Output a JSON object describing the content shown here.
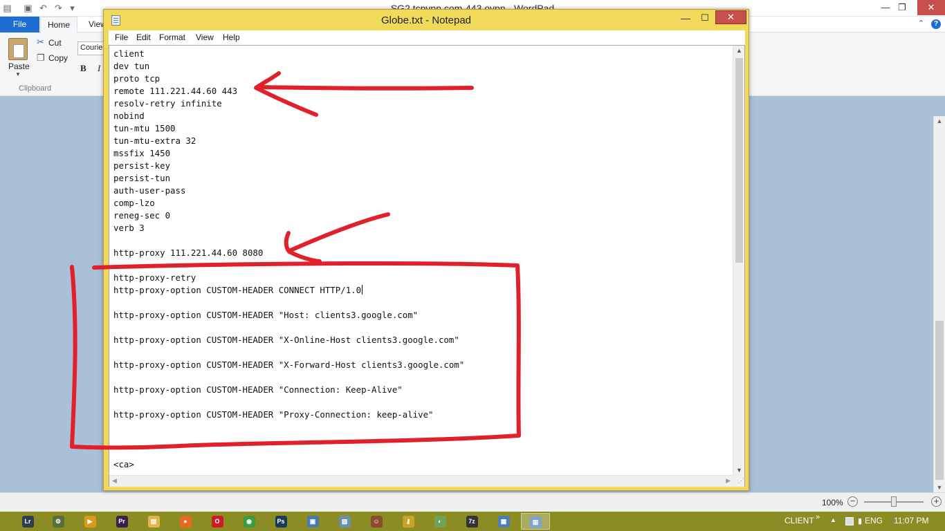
{
  "wordpad": {
    "title": "SG2.tcpvpn.com-443.ovpn - WordPad",
    "tabs": {
      "file": "File",
      "home": "Home",
      "view": "View"
    },
    "ribbon": {
      "paste": "Paste",
      "cut": "Cut",
      "copy": "Copy",
      "clipboard_group": "Clipboard",
      "font_name": "Courier",
      "bold": "B",
      "italic": "I"
    },
    "status": {
      "zoom": "100%"
    }
  },
  "notepad": {
    "title": "Globe.txt - Notepad",
    "menu": [
      "File",
      "Edit",
      "Format",
      "View",
      "Help"
    ],
    "lines": [
      "client",
      "dev tun",
      "proto tcp",
      "remote 111.221.44.60 443",
      "resolv-retry infinite",
      "nobind",
      "tun-mtu 1500",
      "tun-mtu-extra 32",
      "mssfix 1450",
      "persist-key",
      "persist-tun",
      "auth-user-pass",
      "comp-lzo",
      "reneg-sec 0",
      "verb 3",
      "",
      "http-proxy 111.221.44.60 8080",
      "",
      "http-proxy-retry",
      "http-proxy-option CUSTOM-HEADER CONNECT HTTP/1.0",
      "",
      "http-proxy-option CUSTOM-HEADER \"Host: clients3.google.com\"",
      "",
      "http-proxy-option CUSTOM-HEADER \"X-Online-Host clients3.google.com\"",
      "",
      "http-proxy-option CUSTOM-HEADER \"X-Forward-Host clients3.google.com\"",
      "",
      "http-proxy-option CUSTOM-HEADER \"Connection: Keep-Alive\"",
      "",
      "http-proxy-option CUSTOM-HEADER \"Proxy-Connection: keep-alive\"",
      "",
      "",
      "",
      "<ca>"
    ],
    "caret_line": 19
  },
  "taskbar": {
    "items": [
      {
        "icon": "lightroom-icon",
        "glyph": "Lr",
        "color": "#2d3e4f"
      },
      {
        "icon": "app-icon",
        "glyph": "⚙",
        "color": "#5b6d3a"
      },
      {
        "icon": "media-player-icon",
        "glyph": "▶",
        "color": "#d89a1c"
      },
      {
        "icon": "premiere-icon",
        "glyph": "Pr",
        "color": "#3b1f4d"
      },
      {
        "icon": "file-explorer-icon",
        "glyph": "▤",
        "color": "#e0b54b"
      },
      {
        "icon": "firefox-icon",
        "glyph": "●",
        "color": "#e56a1e"
      },
      {
        "icon": "opera-icon",
        "glyph": "O",
        "color": "#cc1b24"
      },
      {
        "icon": "chrome-icon",
        "glyph": "◉",
        "color": "#3d9a41"
      },
      {
        "icon": "photoshop-icon",
        "glyph": "Ps",
        "color": "#1b3a58"
      },
      {
        "icon": "network-app-icon",
        "glyph": "▣",
        "color": "#4a7ab0"
      },
      {
        "icon": "image-viewer-icon",
        "glyph": "▨",
        "color": "#6a8fa8"
      },
      {
        "icon": "game-icon",
        "glyph": "☺",
        "color": "#8a4b2e"
      },
      {
        "icon": "vpn-key-icon",
        "glyph": "⚷",
        "color": "#c9a227"
      },
      {
        "icon": "paint-icon",
        "glyph": "◐",
        "color": "#6fa35a"
      },
      {
        "icon": "7zip-icon",
        "glyph": "7z",
        "color": "#333333"
      },
      {
        "icon": "wordpad-icon",
        "glyph": "▦",
        "color": "#4f7fb8"
      },
      {
        "icon": "notepad-icon",
        "glyph": "▥",
        "color": "#7ea4c7",
        "active": true
      }
    ],
    "tray": {
      "client": "CLIENT",
      "language": "ENG",
      "time": "11:07 PM"
    }
  },
  "colors": {
    "annotation": "#e0202a",
    "taskbar": "#8b8c23",
    "notepad_frame": "#f1d95a",
    "file_tab": "#1e6fd1"
  }
}
